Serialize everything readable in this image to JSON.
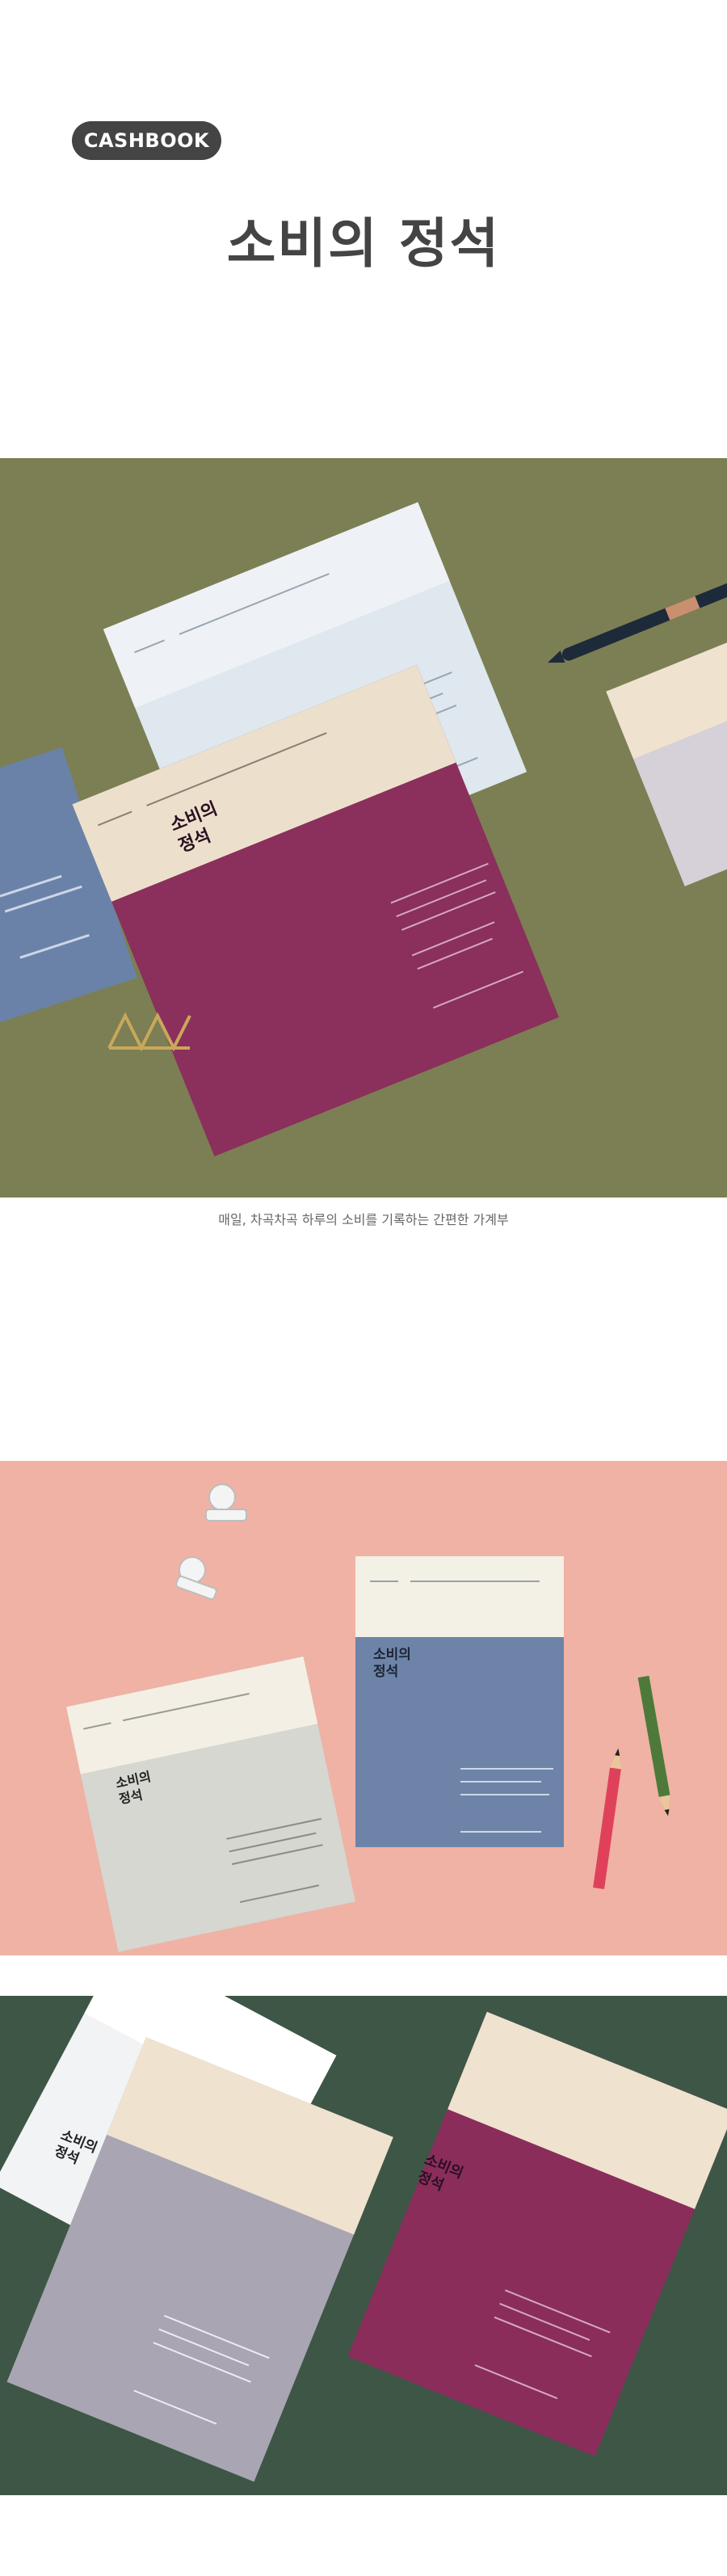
{
  "header": {
    "badge": "CASHBOOK",
    "title": "소비의 정석"
  },
  "caption": "매일, 차곡차곡 하루의 소비를 기록하는 간편한 가계부",
  "covers": {
    "title_line1": "소비의",
    "title_line2": "정석",
    "title_line1_alt": "소비의",
    "title_line2_alt": "정석"
  },
  "colors": {
    "photo1_bg": "#7a7f52",
    "photo2_bg": "#eeb1a4",
    "photo3_bg": "#3f5a47",
    "plum": "#8e2f5e",
    "cream": "#efe3cf",
    "pale_blue": "#d6e0ea",
    "slate_blue": "#6a82a8",
    "grey_green": "#d4d6cf",
    "lavender_grey": "#a8a4b2",
    "badge": "#444444"
  }
}
